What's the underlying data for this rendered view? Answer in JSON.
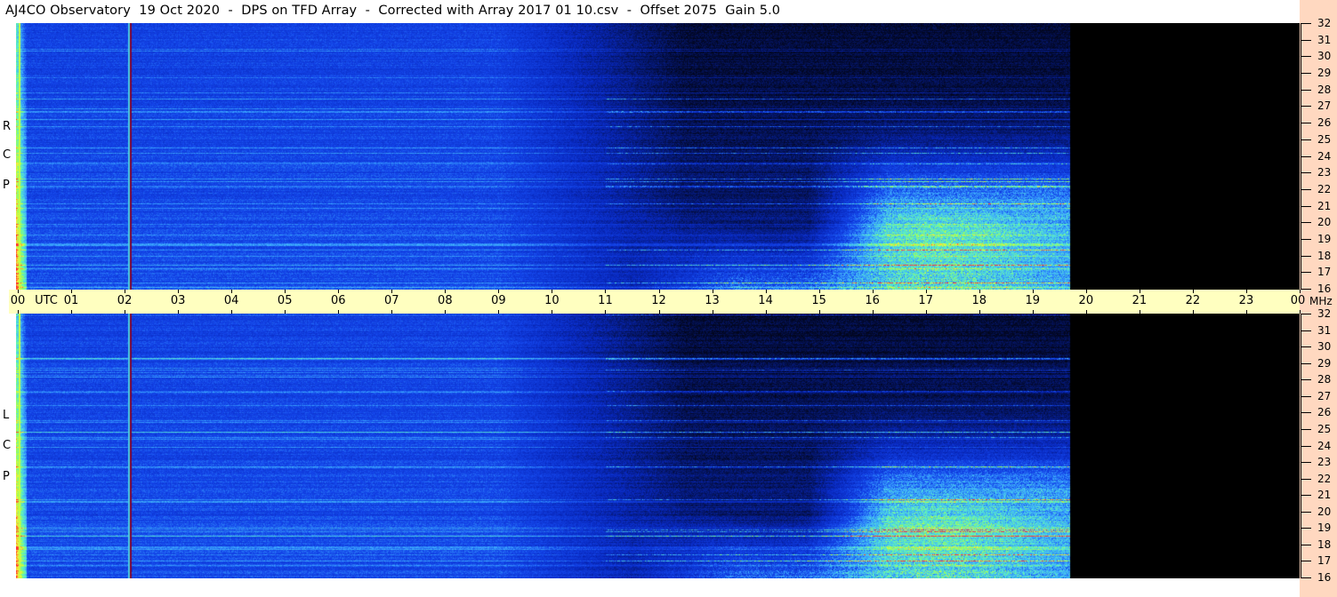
{
  "title": "AJ4CO Observatory  19 Oct 2020  -  DPS on TFD Array  -  Corrected with Array 2017 01 10.csv  -  Offset 2075  Gain 5.0",
  "panels": [
    {
      "id": "rcp",
      "letters": [
        "R",
        "C",
        "P"
      ]
    },
    {
      "id": "lcp",
      "letters": [
        "L",
        "C",
        "P"
      ]
    }
  ],
  "time_axis": {
    "labels": [
      "00",
      "01",
      "02",
      "03",
      "04",
      "05",
      "06",
      "07",
      "08",
      "09",
      "10",
      "11",
      "12",
      "13",
      "14",
      "15",
      "16",
      "17",
      "18",
      "19",
      "20",
      "21",
      "22",
      "23",
      "00"
    ],
    "unit_label": "UTC"
  },
  "freq_axis": {
    "labels": [
      "32",
      "31",
      "30",
      "29",
      "28",
      "27",
      "26",
      "25",
      "24",
      "23",
      "22",
      "21",
      "20",
      "19",
      "18",
      "17",
      "16"
    ],
    "unit_label": "MHz"
  },
  "chart_data": {
    "type": "heatmap",
    "x_range_utc_hours": [
      0,
      24
    ],
    "y_range_mhz": [
      16,
      32
    ],
    "data_end_utc_hours": 20,
    "colors": {
      "background_level": "#0a3ed6",
      "quiet_level": "#021040",
      "no_data": "#000000",
      "burst_cyan": "#4fc3ff",
      "burst_green": "#8cff5a",
      "burst_yellow": "#fff050",
      "burst_red": "#ff3030",
      "marker_line": "#c0ffff",
      "marker_dark": "#800030"
    },
    "features": [
      {
        "desc": "strong vertical artifact",
        "utc": 2.1
      },
      {
        "desc": "data ends, black region",
        "utc": 20
      }
    ]
  }
}
